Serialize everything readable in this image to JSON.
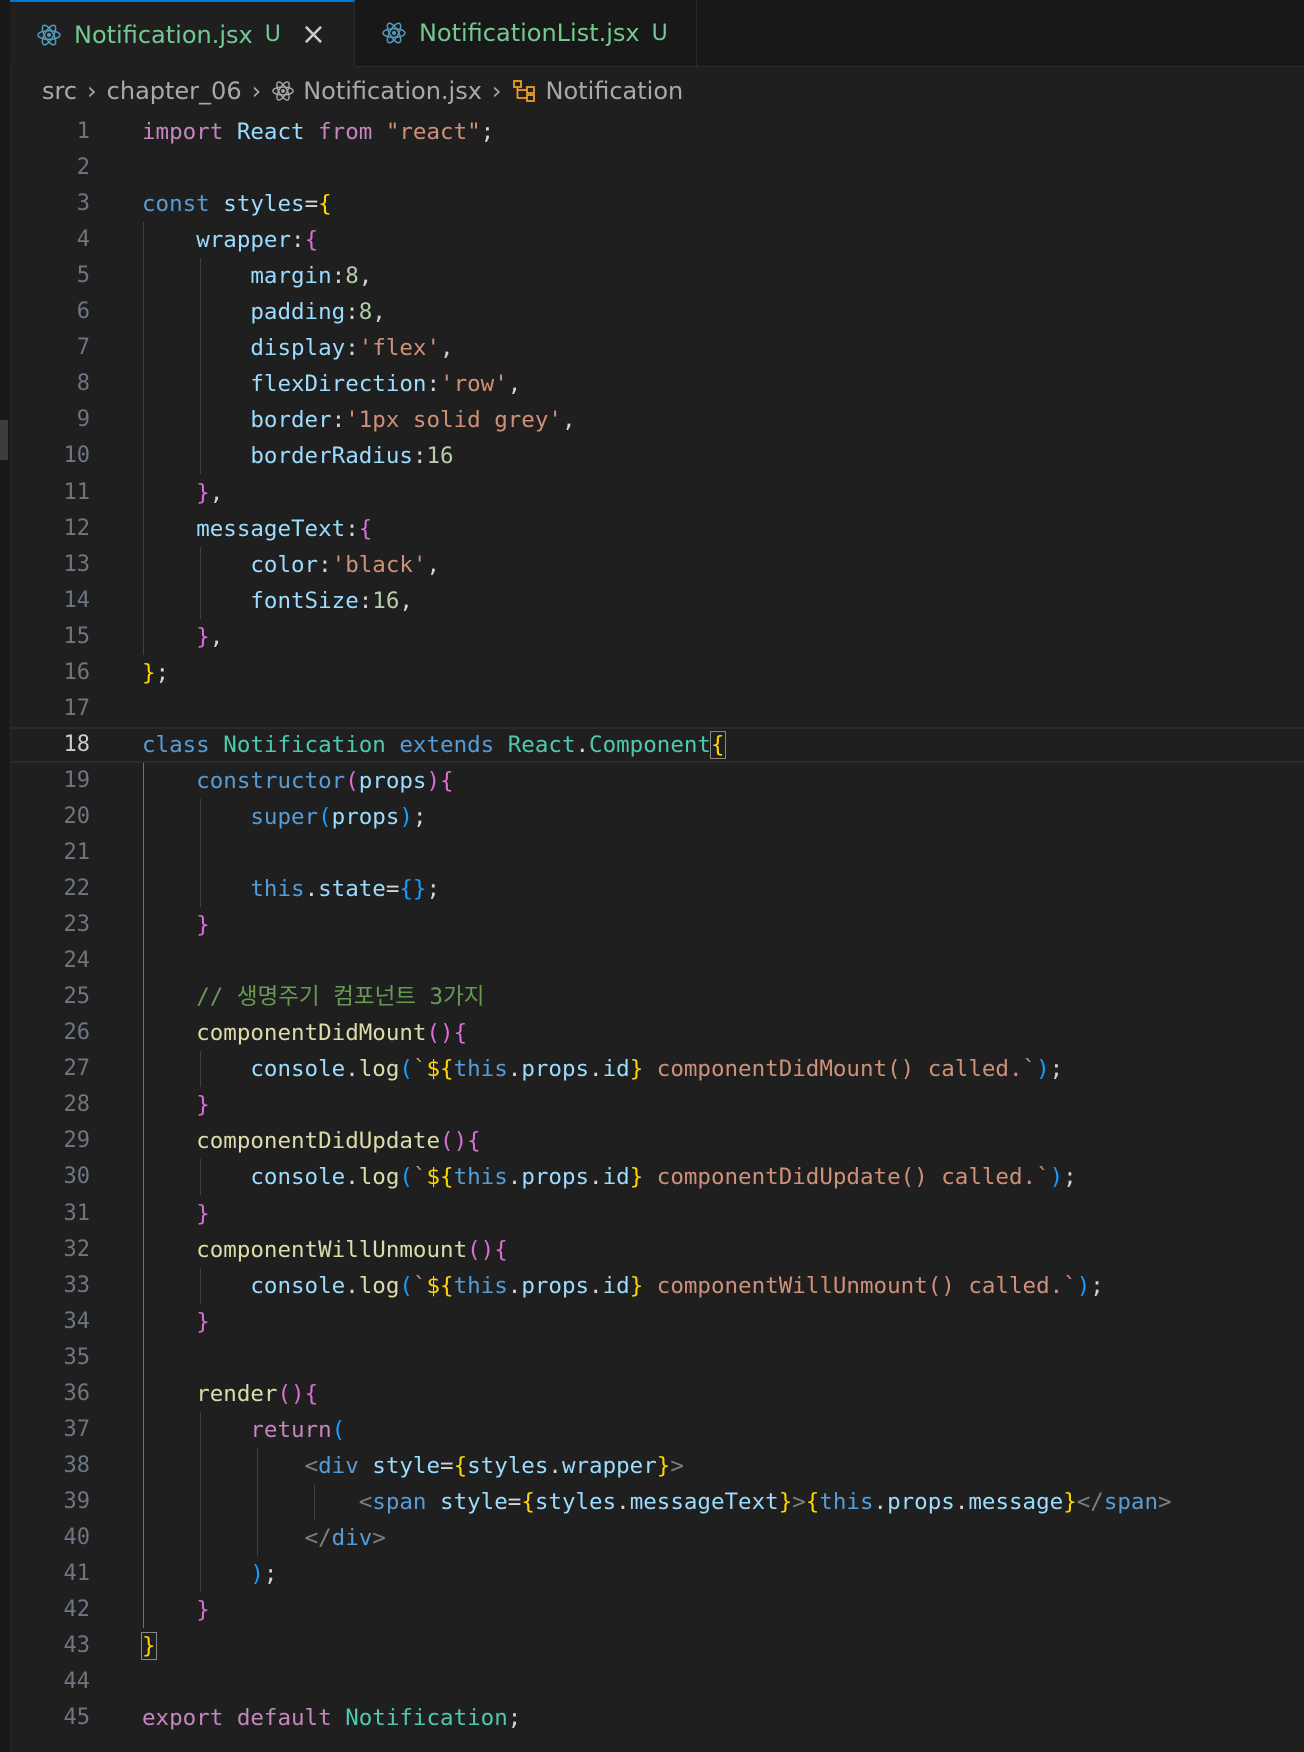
{
  "tabs": [
    {
      "label": "Notification.jsx",
      "status": "U",
      "active": true,
      "icon": "react-icon"
    },
    {
      "label": "NotificationList.jsx",
      "status": "U",
      "active": false,
      "icon": "react-icon"
    }
  ],
  "breadcrumb": {
    "parts": [
      "src",
      "chapter_06",
      "Notification.jsx",
      "Notification"
    ]
  },
  "editor": {
    "current_line": 18,
    "lines": [
      [
        [
          "kw",
          "import"
        ],
        [
          "pl",
          " "
        ],
        [
          "var",
          "React"
        ],
        [
          "pl",
          " "
        ],
        [
          "kw",
          "from"
        ],
        [
          "pl",
          " "
        ],
        [
          "str",
          "\"react\""
        ],
        [
          "pl",
          ";"
        ]
      ],
      [],
      [
        [
          "st",
          "const"
        ],
        [
          "pl",
          " "
        ],
        [
          "var",
          "styles"
        ],
        [
          "pl",
          "="
        ],
        [
          "b1",
          "{"
        ]
      ],
      [
        [
          "pl",
          "    "
        ],
        [
          "var",
          "wrapper"
        ],
        [
          "pl",
          ":"
        ],
        [
          "b2",
          "{"
        ]
      ],
      [
        [
          "pl",
          "        "
        ],
        [
          "var",
          "margin"
        ],
        [
          "pl",
          ":"
        ],
        [
          "num",
          "8"
        ],
        [
          "pl",
          ","
        ]
      ],
      [
        [
          "pl",
          "        "
        ],
        [
          "var",
          "padding"
        ],
        [
          "pl",
          ":"
        ],
        [
          "num",
          "8"
        ],
        [
          "pl",
          ","
        ]
      ],
      [
        [
          "pl",
          "        "
        ],
        [
          "var",
          "display"
        ],
        [
          "pl",
          ":"
        ],
        [
          "str",
          "'flex'"
        ],
        [
          "pl",
          ","
        ]
      ],
      [
        [
          "pl",
          "        "
        ],
        [
          "var",
          "flexDirection"
        ],
        [
          "pl",
          ":"
        ],
        [
          "str",
          "'row'"
        ],
        [
          "pl",
          ","
        ]
      ],
      [
        [
          "pl",
          "        "
        ],
        [
          "var",
          "border"
        ],
        [
          "pl",
          ":"
        ],
        [
          "str",
          "'1px solid grey'"
        ],
        [
          "pl",
          ","
        ]
      ],
      [
        [
          "pl",
          "        "
        ],
        [
          "var",
          "borderRadius"
        ],
        [
          "pl",
          ":"
        ],
        [
          "num",
          "16"
        ]
      ],
      [
        [
          "pl",
          "    "
        ],
        [
          "b2",
          "}"
        ],
        [
          "pl",
          ","
        ]
      ],
      [
        [
          "pl",
          "    "
        ],
        [
          "var",
          "messageText"
        ],
        [
          "pl",
          ":"
        ],
        [
          "b2",
          "{"
        ]
      ],
      [
        [
          "pl",
          "        "
        ],
        [
          "var",
          "color"
        ],
        [
          "pl",
          ":"
        ],
        [
          "str",
          "'black'"
        ],
        [
          "pl",
          ","
        ]
      ],
      [
        [
          "pl",
          "        "
        ],
        [
          "var",
          "fontSize"
        ],
        [
          "pl",
          ":"
        ],
        [
          "num",
          "16"
        ],
        [
          "pl",
          ","
        ]
      ],
      [
        [
          "pl",
          "    "
        ],
        [
          "b2",
          "}"
        ],
        [
          "pl",
          ","
        ]
      ],
      [
        [
          "b1",
          "}"
        ],
        [
          "pl",
          ";"
        ]
      ],
      [],
      [
        [
          "st",
          "class"
        ],
        [
          "pl",
          " "
        ],
        [
          "cls",
          "Notification"
        ],
        [
          "pl",
          " "
        ],
        [
          "st",
          "extends"
        ],
        [
          "pl",
          " "
        ],
        [
          "cls",
          "React"
        ],
        [
          "pl",
          "."
        ],
        [
          "cls",
          "Component"
        ],
        [
          "b1box",
          "{"
        ]
      ],
      [
        [
          "pl",
          "    "
        ],
        [
          "st",
          "constructor"
        ],
        [
          "b2",
          "("
        ],
        [
          "var",
          "props"
        ],
        [
          "b2",
          ")"
        ],
        [
          "b2",
          "{"
        ]
      ],
      [
        [
          "pl",
          "        "
        ],
        [
          "st",
          "super"
        ],
        [
          "b3",
          "("
        ],
        [
          "var",
          "props"
        ],
        [
          "b3",
          ")"
        ],
        [
          "pl",
          ";"
        ]
      ],
      [],
      [
        [
          "pl",
          "        "
        ],
        [
          "st",
          "this"
        ],
        [
          "pl",
          "."
        ],
        [
          "var",
          "state"
        ],
        [
          "pl",
          "="
        ],
        [
          "b3",
          "{}"
        ],
        [
          "pl",
          ";"
        ]
      ],
      [
        [
          "pl",
          "    "
        ],
        [
          "b2",
          "}"
        ]
      ],
      [],
      [
        [
          "pl",
          "    "
        ],
        [
          "cm",
          "// 생명주기 컴포넌트 3가지"
        ]
      ],
      [
        [
          "pl",
          "    "
        ],
        [
          "fn",
          "componentDidMount"
        ],
        [
          "b2",
          "()"
        ],
        [
          "b2",
          "{"
        ]
      ],
      [
        [
          "pl",
          "        "
        ],
        [
          "var",
          "console"
        ],
        [
          "pl",
          "."
        ],
        [
          "fn",
          "log"
        ],
        [
          "b3",
          "("
        ],
        [
          "str",
          "`"
        ],
        [
          "b1",
          "${"
        ],
        [
          "st",
          "this"
        ],
        [
          "pl",
          "."
        ],
        [
          "var",
          "props"
        ],
        [
          "pl",
          "."
        ],
        [
          "var",
          "id"
        ],
        [
          "b1",
          "}"
        ],
        [
          "str",
          " componentDidMount() called.`"
        ],
        [
          "b3",
          ")"
        ],
        [
          "pl",
          ";"
        ]
      ],
      [
        [
          "pl",
          "    "
        ],
        [
          "b2",
          "}"
        ]
      ],
      [
        [
          "pl",
          "    "
        ],
        [
          "fn",
          "componentDidUpdate"
        ],
        [
          "b2",
          "()"
        ],
        [
          "b2",
          "{"
        ]
      ],
      [
        [
          "pl",
          "        "
        ],
        [
          "var",
          "console"
        ],
        [
          "pl",
          "."
        ],
        [
          "fn",
          "log"
        ],
        [
          "b3",
          "("
        ],
        [
          "str",
          "`"
        ],
        [
          "b1",
          "${"
        ],
        [
          "st",
          "this"
        ],
        [
          "pl",
          "."
        ],
        [
          "var",
          "props"
        ],
        [
          "pl",
          "."
        ],
        [
          "var",
          "id"
        ],
        [
          "b1",
          "}"
        ],
        [
          "str",
          " componentDidUpdate() called.`"
        ],
        [
          "b3",
          ")"
        ],
        [
          "pl",
          ";"
        ]
      ],
      [
        [
          "pl",
          "    "
        ],
        [
          "b2",
          "}"
        ]
      ],
      [
        [
          "pl",
          "    "
        ],
        [
          "fn",
          "componentWillUnmount"
        ],
        [
          "b2",
          "()"
        ],
        [
          "b2",
          "{"
        ]
      ],
      [
        [
          "pl",
          "        "
        ],
        [
          "var",
          "console"
        ],
        [
          "pl",
          "."
        ],
        [
          "fn",
          "log"
        ],
        [
          "b3",
          "("
        ],
        [
          "str",
          "`"
        ],
        [
          "b1",
          "${"
        ],
        [
          "st",
          "this"
        ],
        [
          "pl",
          "."
        ],
        [
          "var",
          "props"
        ],
        [
          "pl",
          "."
        ],
        [
          "var",
          "id"
        ],
        [
          "b1",
          "}"
        ],
        [
          "str",
          " componentWillUnmount() called.`"
        ],
        [
          "b3",
          ")"
        ],
        [
          "pl",
          ";"
        ]
      ],
      [
        [
          "pl",
          "    "
        ],
        [
          "b2",
          "}"
        ]
      ],
      [],
      [
        [
          "pl",
          "    "
        ],
        [
          "fn",
          "render"
        ],
        [
          "b2",
          "()"
        ],
        [
          "b2",
          "{"
        ]
      ],
      [
        [
          "pl",
          "        "
        ],
        [
          "kw",
          "return"
        ],
        [
          "b3",
          "("
        ]
      ],
      [
        [
          "pl",
          "            "
        ],
        [
          "tgr",
          "<"
        ],
        [
          "tag",
          "div"
        ],
        [
          "pl",
          " "
        ],
        [
          "var",
          "style"
        ],
        [
          "pl",
          "="
        ],
        [
          "b1",
          "{"
        ],
        [
          "var",
          "styles"
        ],
        [
          "pl",
          "."
        ],
        [
          "var",
          "wrapper"
        ],
        [
          "b1",
          "}"
        ],
        [
          "tgr",
          ">"
        ]
      ],
      [
        [
          "pl",
          "                "
        ],
        [
          "tgr",
          "<"
        ],
        [
          "tag",
          "span"
        ],
        [
          "pl",
          " "
        ],
        [
          "var",
          "style"
        ],
        [
          "pl",
          "="
        ],
        [
          "b1",
          "{"
        ],
        [
          "var",
          "styles"
        ],
        [
          "pl",
          "."
        ],
        [
          "var",
          "messageText"
        ],
        [
          "b1",
          "}"
        ],
        [
          "tgr",
          ">"
        ],
        [
          "b1",
          "{"
        ],
        [
          "st",
          "this"
        ],
        [
          "pl",
          "."
        ],
        [
          "var",
          "props"
        ],
        [
          "pl",
          "."
        ],
        [
          "var",
          "message"
        ],
        [
          "b1",
          "}"
        ],
        [
          "tgr",
          "</"
        ],
        [
          "tag",
          "span"
        ],
        [
          "tgr",
          ">"
        ]
      ],
      [
        [
          "pl",
          "            "
        ],
        [
          "tgr",
          "</"
        ],
        [
          "tag",
          "div"
        ],
        [
          "tgr",
          ">"
        ]
      ],
      [
        [
          "pl",
          "        "
        ],
        [
          "b3",
          ")"
        ],
        [
          "pl",
          ";"
        ]
      ],
      [
        [
          "pl",
          "    "
        ],
        [
          "b2",
          "}"
        ]
      ],
      [
        [
          "b1box",
          "}"
        ]
      ],
      [],
      [
        [
          "kw",
          "export"
        ],
        [
          "pl",
          " "
        ],
        [
          "kw",
          "default"
        ],
        [
          "pl",
          " "
        ],
        [
          "cls",
          "Notification"
        ],
        [
          "pl",
          ";"
        ]
      ]
    ]
  }
}
